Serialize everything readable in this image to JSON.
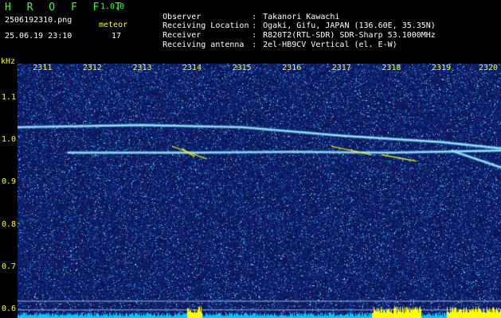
{
  "header": {
    "logo": "H R O F F T",
    "version": "1.0.0",
    "filename": "2506192310.png",
    "timestamp": "25.06.19 23:10",
    "meteor_label": "meteor",
    "meteor_count": "17"
  },
  "info": [
    {
      "key": "Observer",
      "value": "Takanori Kawachi"
    },
    {
      "key": "Receiving Location",
      "value": "Ogaki, Gifu, JAPAN (136.60E, 35.35N)"
    },
    {
      "key": "Receiver",
      "value": "R820T2(RTL-SDR) SDR-Sharp 53.1000MHz"
    },
    {
      "key": "Receiving antenna",
      "value": "2el-HB9CV Vertical (el. E-W)"
    }
  ],
  "info_sep": ":",
  "chart_data": {
    "type": "heatmap",
    "y_unit_label": "kHz",
    "x_ticks": [
      "2311",
      "2312",
      "2313",
      "2314",
      "2315",
      "2316",
      "2317",
      "2318",
      "2319",
      "2320"
    ],
    "y_ticks": [
      "1.1",
      "1.0",
      "0.9",
      "0.8",
      "0.7",
      "0.6"
    ],
    "ylim": [
      0.58,
      1.18
    ],
    "xlim": [
      2310.5,
      2320.2
    ],
    "traces": [
      {
        "name": "carrier-upper",
        "points": [
          [
            2310.5,
            1.03
          ],
          [
            2313,
            1.035
          ],
          [
            2315,
            1.03
          ],
          [
            2317,
            1.01
          ],
          [
            2319,
            0.995
          ],
          [
            2320.2,
            0.98
          ]
        ]
      },
      {
        "name": "carrier-lower",
        "points": [
          [
            2311.5,
            0.97
          ],
          [
            2314,
            0.97
          ],
          [
            2316,
            0.972
          ],
          [
            2318,
            0.97
          ],
          [
            2320.2,
            0.975
          ]
        ]
      },
      {
        "name": "descending",
        "points": [
          [
            2319.2,
            0.975
          ],
          [
            2320.2,
            0.935
          ]
        ]
      }
    ],
    "colors": {
      "background": "#0a0a5a",
      "noise": "#1c2fb0",
      "trace": "#9ff4ff",
      "trace_hot": "#ffff00",
      "meter": "#00c8ff",
      "meter_hot": "#ffff00",
      "axis_text": "#ffff00"
    }
  }
}
